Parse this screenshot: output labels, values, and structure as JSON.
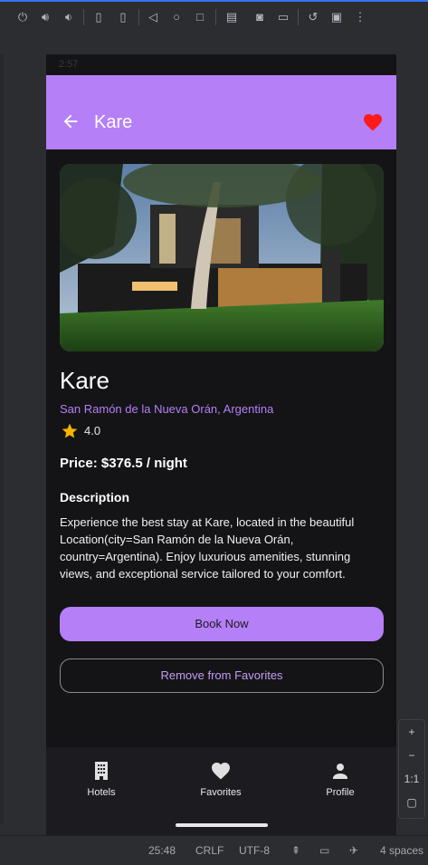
{
  "ide": {
    "toolbar_icons": [
      "power-icon",
      "volume-up-icon",
      "volume-down-icon",
      "rotate-left-icon",
      "rotate-right-icon",
      "back-nav-icon",
      "home-nav-icon",
      "overview-nav-icon",
      "fold-icon",
      "camera-icon",
      "screenrecord-icon",
      "rewind-icon",
      "snapshot-icon",
      "more-icon"
    ],
    "zoom": {
      "plus": "+",
      "minus": "−",
      "ratio": "1:1"
    },
    "status": {
      "position": "25:48",
      "line_sep": "CRLF",
      "encoding": "UTF-8",
      "indent": "4 spaces"
    }
  },
  "device_status": {
    "time": "2:57"
  },
  "app": {
    "title": "Kare",
    "hotel_name": "Kare",
    "location": "San Ramón de la Nueva Orán, Argentina",
    "rating": "4.0",
    "price": "Price: $376.5 / night",
    "description_heading": "Description",
    "description": "Experience the best stay at Kare, located in the beautiful Location(city=San Ramón de la Nueva Orán, country=Argentina). Enjoy luxurious amenities, stunning views, and exceptional service tailored to your comfort.",
    "book_label": "Book Now",
    "remove_label": "Remove from Favorites",
    "nav": [
      {
        "label": "Hotels",
        "icon": "building-icon"
      },
      {
        "label": "Favorites",
        "icon": "heart-icon"
      },
      {
        "label": "Profile",
        "icon": "person-icon"
      }
    ],
    "colors": {
      "primary": "#b57ff7",
      "favorite": "#ff1a1a",
      "star": "#f6b400",
      "background": "#141416"
    }
  }
}
